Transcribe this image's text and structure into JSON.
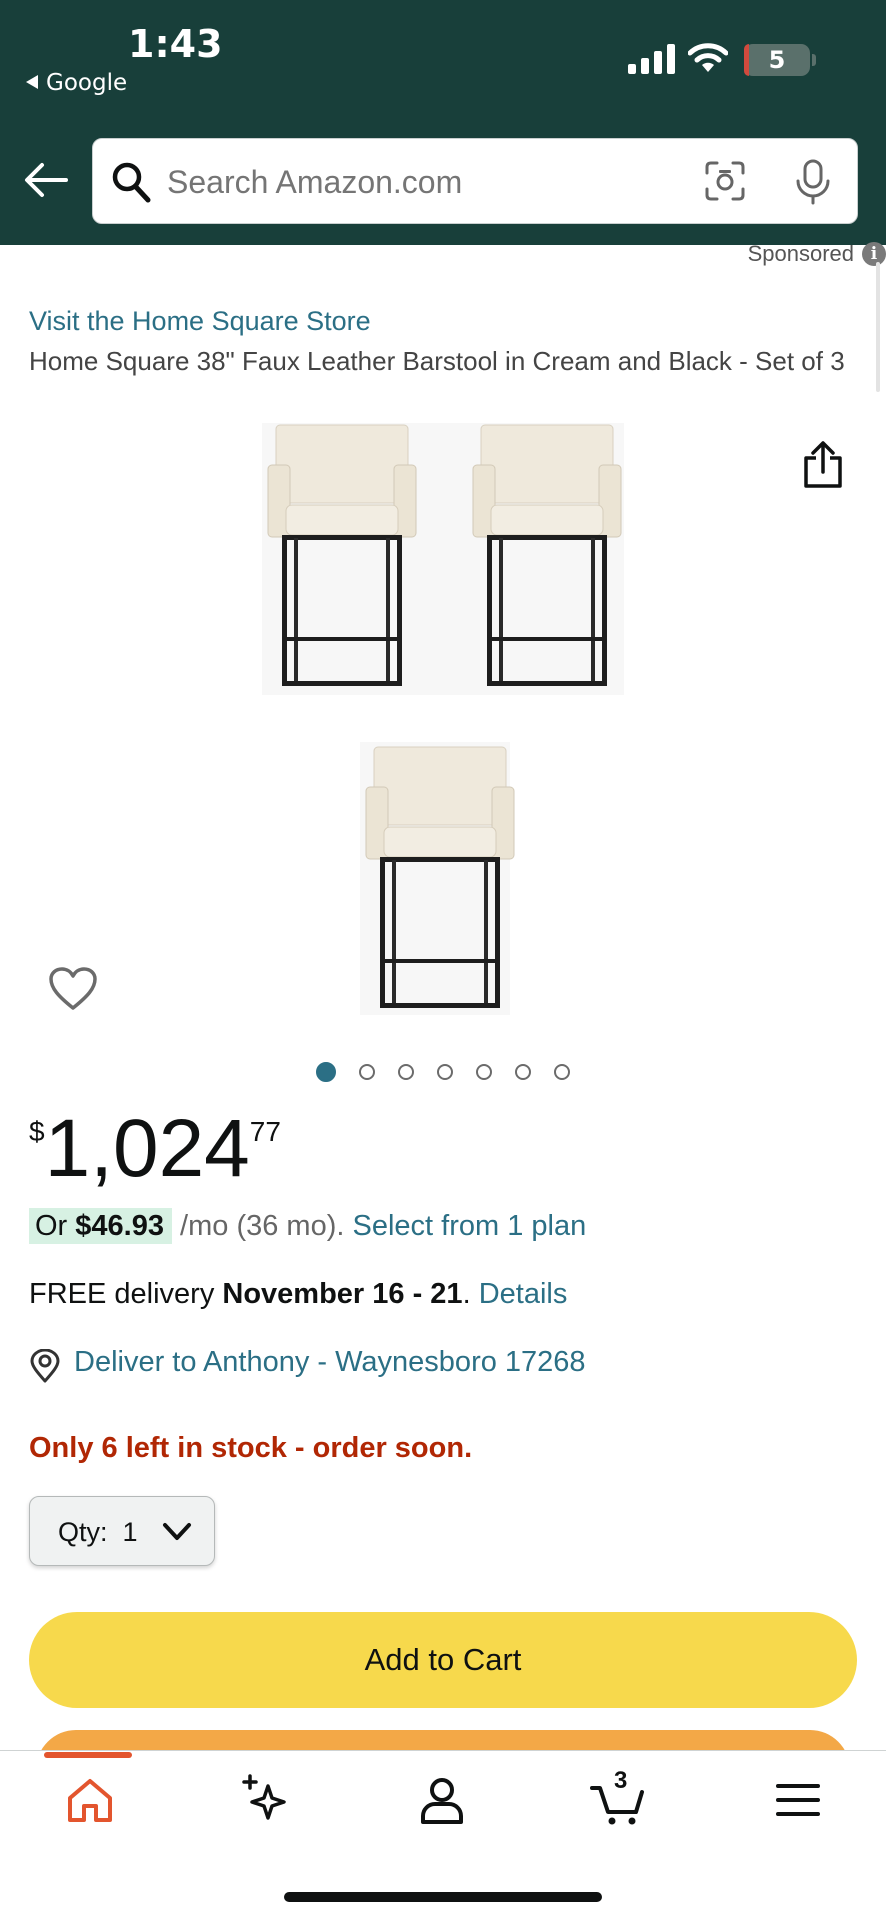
{
  "status_bar": {
    "time": "1:43",
    "back_app": "Google",
    "battery": "5"
  },
  "search": {
    "placeholder": "Search Amazon.com"
  },
  "sponsored_label": "Sponsored",
  "info_glyph": "i",
  "product": {
    "store_link": "Visit the Home Square Store",
    "title": "Home Square 38\" Faux Leather Barstool in Cream and Black - Set of 3",
    "image_count": 7,
    "active_image": 1
  },
  "price": {
    "symbol": "$",
    "whole": "1,024",
    "fraction": "77"
  },
  "installment": {
    "prefix": "Or ",
    "amount": "$46.93",
    "term": "/mo (36 mo).",
    "link": "Select from 1 plan"
  },
  "delivery": {
    "prefix": "FREE delivery ",
    "dates": "November 16 - 21",
    "suffix": ". ",
    "link": "Details"
  },
  "deliver_to": "Deliver to Anthony - Waynesboro 17268",
  "stock": "Only 6 left in stock - order soon.",
  "quantity": {
    "label": "Qty:",
    "value": "1"
  },
  "add_to_cart": "Add to Cart",
  "tabbar": {
    "cart_count": "3",
    "active_tab": "home"
  },
  "colors": {
    "header_bg": "#183f3a",
    "link": "#2b6f85",
    "stock_red": "#b12704",
    "add_to_cart": "#f7d94c",
    "buy_now": "#f3a847",
    "active_tab": "#e3552e"
  },
  "icons": [
    "back-arrow-icon",
    "search-icon",
    "camera-icon",
    "mic-icon",
    "share-icon",
    "heart-icon",
    "location-pin-icon",
    "chevron-down-icon",
    "home-icon",
    "sparkle-icon",
    "person-icon",
    "cart-icon",
    "menu-icon"
  ]
}
